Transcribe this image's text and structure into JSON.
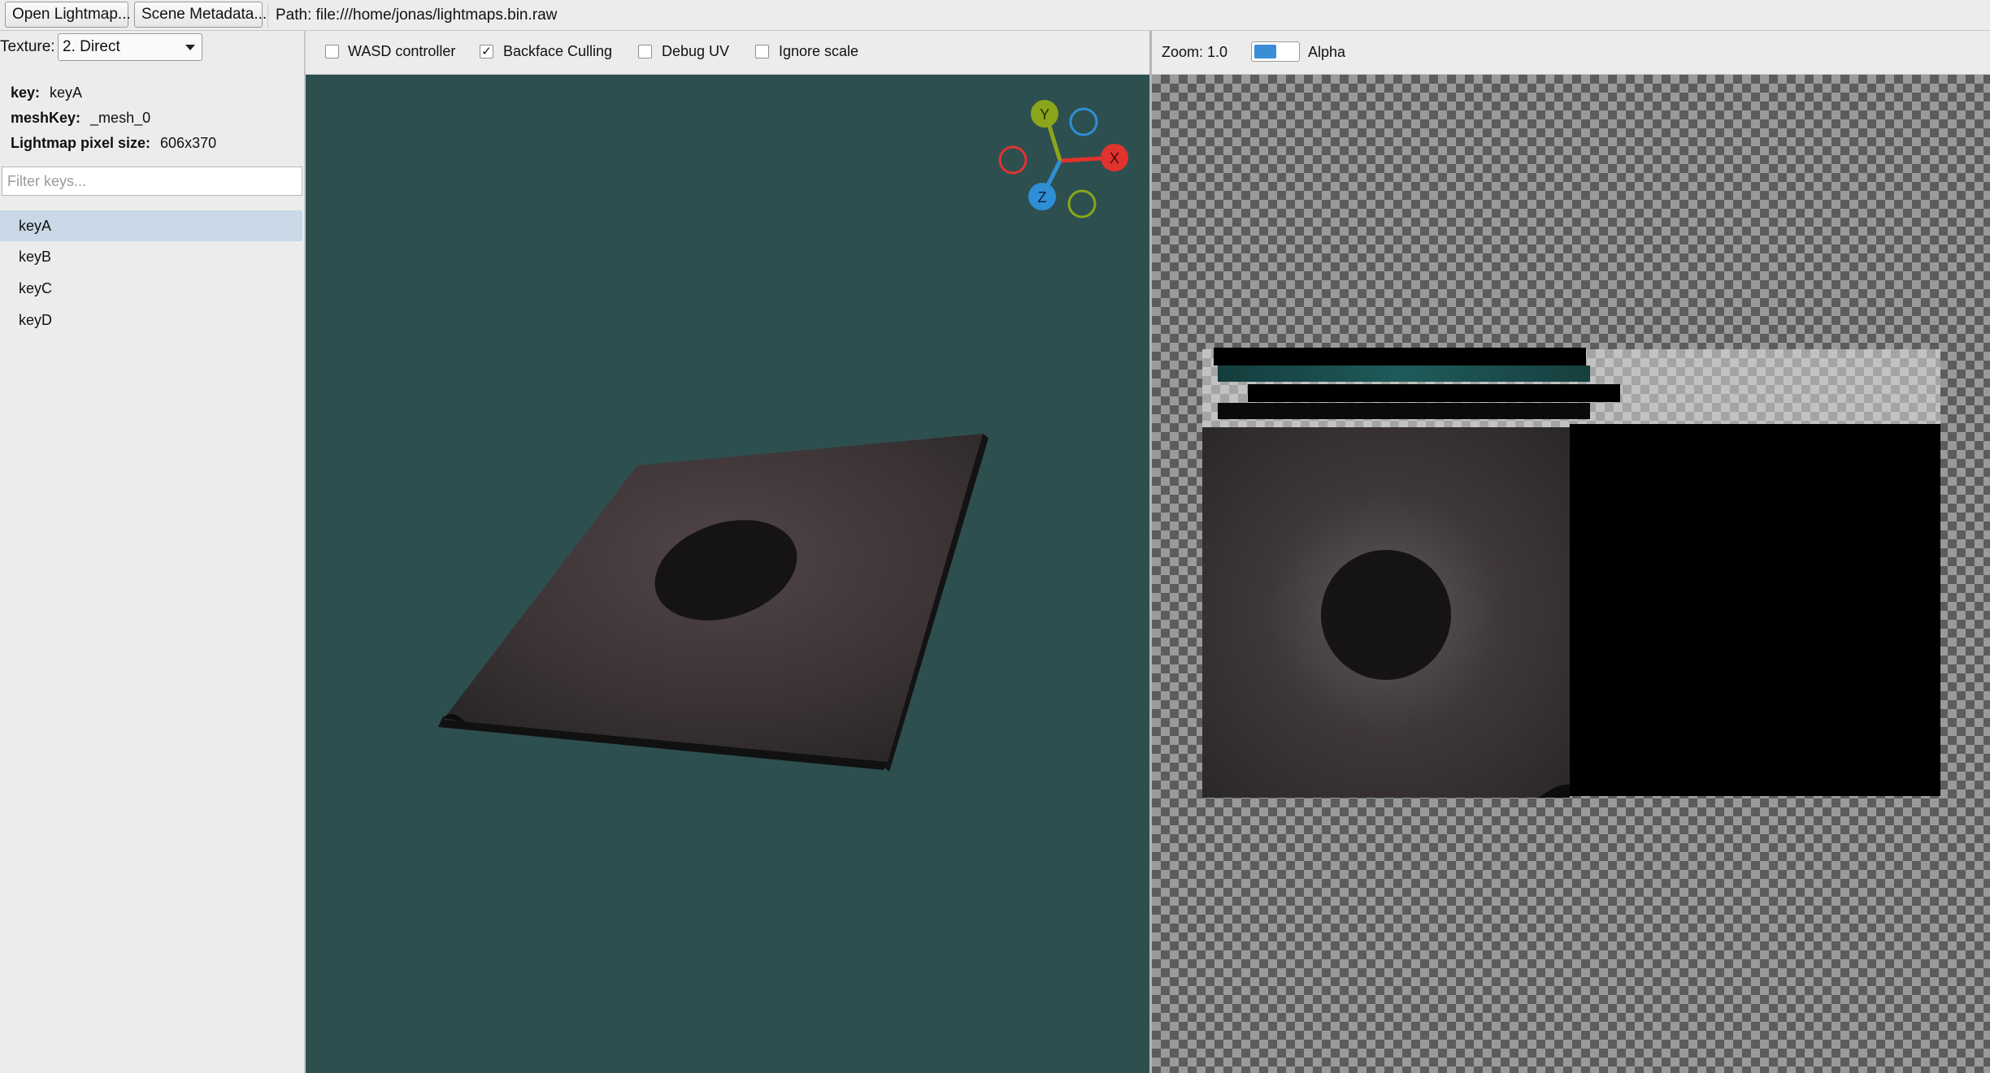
{
  "toolbar": {
    "open_lightmap_label": "Open Lightmap...",
    "scene_metadata_label": "Scene Metadata...",
    "path_text": "Path: file:///home/jonas/lightmaps.bin.raw"
  },
  "left_panel": {
    "texture_label": "Texture:",
    "texture_selected": "2. Direct",
    "info": {
      "key_label": "key:",
      "key_value": "keyA",
      "mesh_key_label": "meshKey:",
      "mesh_key_value": "_mesh_0",
      "pixel_size_label": "Lightmap pixel size:",
      "pixel_size_value": "606x370"
    },
    "filter_placeholder": "Filter keys...",
    "keys": [
      "keyA",
      "keyB",
      "keyC",
      "keyD"
    ],
    "selected_key": "keyA"
  },
  "viewport": {
    "options": [
      {
        "label": "WASD controller",
        "checked": false
      },
      {
        "label": "Backface Culling",
        "checked": true
      },
      {
        "label": "Debug UV",
        "checked": false
      },
      {
        "label": "Ignore scale",
        "checked": false
      }
    ],
    "background_color": "#2e4f4f",
    "gizmo": {
      "x_label": "X",
      "y_label": "Y",
      "z_label": "Z",
      "x_color": "#e0332e",
      "y_color": "#8aa61a",
      "z_color": "#2e8fd6"
    }
  },
  "preview": {
    "zoom_text": "Zoom: 1.0",
    "alpha_label": "Alpha",
    "alpha_enabled": true,
    "accent_color": "#3a8ed6"
  }
}
